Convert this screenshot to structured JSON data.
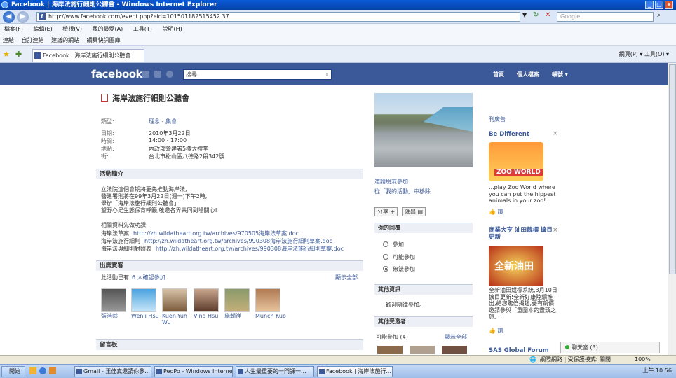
{
  "browser": {
    "title": "Facebook | 海岸法施行細則公聽會 - Windows Internet Explorer",
    "address": "http://www.facebook.com/event.php?eid=101501182515452 37",
    "search_placeholder": "Google",
    "menu": [
      "檔案(F)",
      "編輯(E)",
      "檢視(V)",
      "我的最愛(A)",
      "工具(T)",
      "說明(H)"
    ],
    "links": [
      "連結",
      "自訂連結",
      "建議的網站",
      "網頁快訊圖庫"
    ],
    "tab_title": "Facebook | 海岸法施行細則公聽會",
    "cmdbar": "網頁(P) ▾  工具(O) ▾"
  },
  "fb": {
    "logo": "facebook",
    "search": "搜尋",
    "nav": [
      "首頁",
      "個人檔案",
      "帳號 ▾"
    ]
  },
  "event": {
    "title": "海岸法施行細則公聽會",
    "type_label": "類型:",
    "type_value": "理念 - 集會",
    "date_label": "日期:",
    "date_value": "2010年3月22日",
    "time_label": "時間:",
    "time_value": "14:00 - 17:00",
    "place_label": "地點:",
    "place_value": "內政部營建署5樓大禮堂",
    "street_label": "街:",
    "street_value": "台北市松山區八德路2段342號",
    "intro_header": "活動簡介",
    "intro_lines": [
      "立法院這個會期將要先推動海岸法,",
      "營建署則將在99年3月22日(週一)下午2時,",
      "舉辦「海岸法施行細則公聽會」",
      "望野心足生態保育呼籲,敬邀各界共同到場關心!"
    ],
    "ref_intro": "相關資料先做功課:",
    "refs": [
      {
        "label": "海岸法草案",
        "url": "http://zh.wildatheart.org.tw/archives/970505海岸法草案.doc"
      },
      {
        "label": "海岸法施行細則",
        "url": "http://zh.wildatheart.org.tw/archives/990308海岸法施行細則草案.doc"
      },
      {
        "label": "海岸法與細則對照表",
        "url": "http://zh.wildatheart.org.tw/archives/990308海岸法施行細則草案.doc"
      }
    ],
    "guests_header": "出席賓客",
    "guests_text": "此活動已有",
    "guests_count": "6 人確認參加",
    "show_all": "顯示全部",
    "guests": [
      "張浩然",
      "Wenli Hsu",
      "Kuen-Yuh Wu",
      "Vina Hsu",
      "施朝祥",
      "Munch Kuo"
    ],
    "wall_header": "留言板"
  },
  "mid": {
    "invite": "邀請朋友參加",
    "remove": "從「我的活動」中移除",
    "share": "分享",
    "export": "匯出",
    "rsvp_header": "你的回覆",
    "rsvp": [
      "參加",
      "可能參加",
      "無法參加"
    ],
    "rsvp_selected": 2,
    "info_header": "其他資訊",
    "info_text": "歡迎隨律參加。",
    "others_header": "其他受邀者",
    "maybe": "可能參加 (4)",
    "show_all": "顯示全部"
  },
  "ads": {
    "label": "刊廣告",
    "ad1_title": "Be Different",
    "ad1_img": "ZOO WORLD",
    "ad1_text": "...play Zoo World where you can put the hippest animals in your zoo!",
    "ad2_title": "商業大亨 油田競標 擴目更新",
    "ad2_img": "全新油田",
    "ad2_text": "全新油田競標系統,3月10日擴目更新!全新好康陸續推出,給您驚倍揭趣,要有競價邀請參與「重圍本的盡頭之旅」!",
    "like": "讚",
    "ad3_title": "SAS Global Forum"
  },
  "chat": "聊天室 (3)",
  "status": {
    "mode": "網際網路 | 受保護模式: 關閉",
    "zoom": "100%"
  },
  "taskbar": {
    "start": "開始",
    "tasks": [
      "Gmail - 王佳真邀請你參...",
      "PeoPo - Windows Internet...",
      "人生最重要的一門課一...",
      "Facebook | 海岸法施行..."
    ],
    "clock": "上午 10:56"
  }
}
